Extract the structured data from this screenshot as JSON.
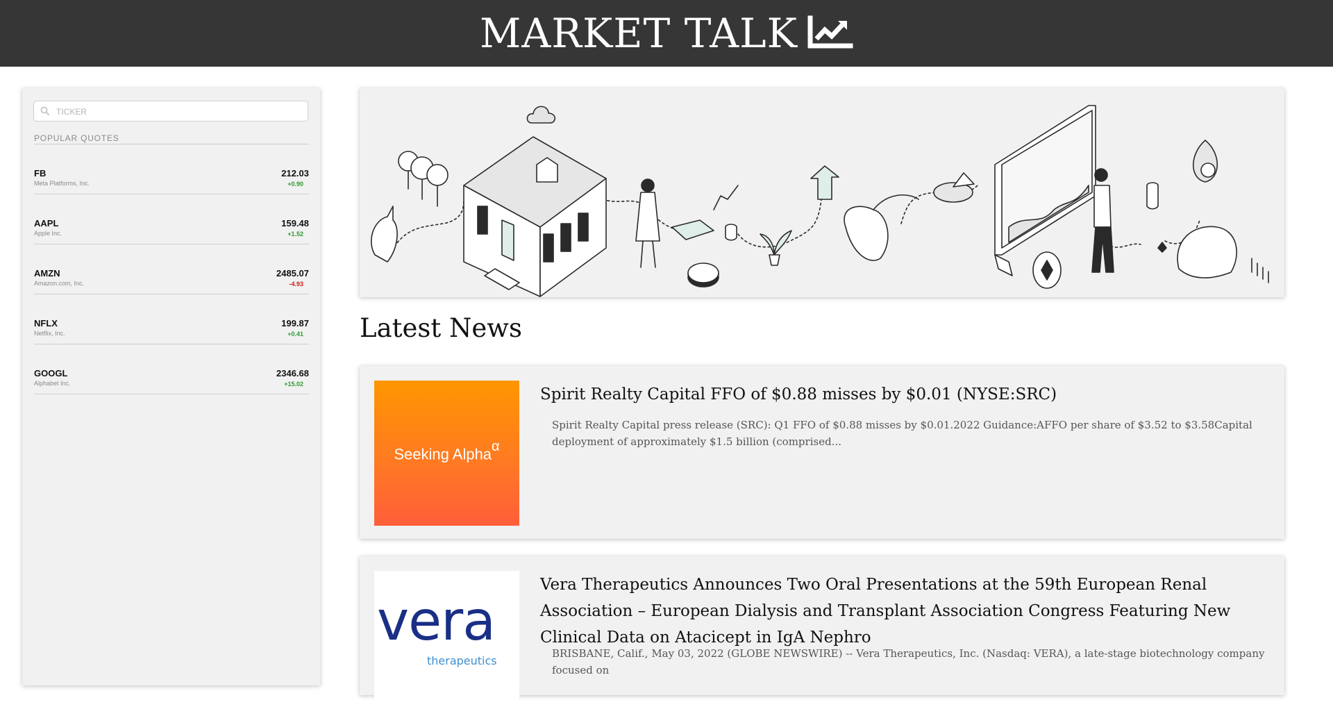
{
  "header": {
    "title": "MARKET TALK",
    "icon": "line-chart-icon"
  },
  "sidebar": {
    "search": {
      "placeholder": "TICKER",
      "value": "",
      "icon": "search-icon"
    },
    "popular_label": "POPULAR QUOTES",
    "quotes": [
      {
        "symbol": "FB",
        "name": "Meta Platforms, Inc.",
        "price": "212.03",
        "change": "+0.90",
        "direction": "up"
      },
      {
        "symbol": "AAPL",
        "name": "Apple Inc.",
        "price": "159.48",
        "change": "+1.52",
        "direction": "up"
      },
      {
        "symbol": "AMZN",
        "name": "Amazon.com, Inc.",
        "price": "2485.07",
        "change": "-4.93",
        "direction": "down"
      },
      {
        "symbol": "NFLX",
        "name": "Netflix, Inc.",
        "price": "199.87",
        "change": "+0.41",
        "direction": "up"
      },
      {
        "symbol": "GOOGL",
        "name": "Alphabet Inc.",
        "price": "2346.68",
        "change": "+15.02",
        "direction": "up"
      }
    ]
  },
  "main": {
    "hero_alt": "finance-illustration",
    "news_title": "Latest News",
    "articles": [
      {
        "thumb_text": "Seeking Alpha",
        "thumb_sup": "α",
        "headline": "Spirit Realty Capital FFO of $0.88 misses by $0.01 (NYSE:SRC)",
        "summary": "Spirit Realty Capital press release (SRC): Q1 FFO of $0.88 misses by $0.01.2022 Guidance:AFFO per share of $3.52 to $3.58Capital deployment of approximately $1.5 billion (comprised..."
      },
      {
        "thumb_text": "vera",
        "thumb_sub": "therapeutics",
        "headline": "Vera Therapeutics Announces Two Oral Presentations at the 59th European Renal Association – European Dialysis and Transplant Association Congress Featuring New Clinical Data on Atacicept in IgA Nephro",
        "summary": "BRISBANE, Calif., May 03, 2022 (GLOBE NEWSWIRE) -- Vera Therapeutics, Inc. (Nasdaq: VERA), a late-stage biotechnology company focused on"
      }
    ]
  },
  "colors": {
    "header_bg": "#363636",
    "panel_bg": "#f1f1f1",
    "positive": "#2e9a2e",
    "negative": "#d11a1a",
    "seeking_alpha_top": "#ff9600",
    "seeking_alpha_bottom": "#ff5e3a",
    "vera_navy": "#1a2f86"
  }
}
